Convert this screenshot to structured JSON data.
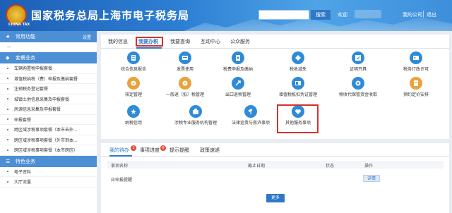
{
  "header": {
    "logo_text": "CHINA TAX",
    "title": "国家税务总局上海市电子税务局",
    "search_label": "搜索",
    "welcome": "欢迎",
    "my_company": "我的公司",
    "logout": "退出"
  },
  "sidebar": {
    "common": {
      "label": "常用功能",
      "settings": "设置",
      "items": [
        "--"
      ]
    },
    "business": {
      "label": "套餐业务",
      "items": [
        "车辆购置税申报套餐",
        "增值税纳税（费）申报及缴纳套餐",
        "注销税务登记套餐",
        "城镇土地信息采集及申报套餐",
        "房源信息采集及申报套餐",
        "申报套餐",
        "跨区域涉税事项套餐（本市去外...",
        "跨区域涉税事项套餐（外市到本...",
        "跨区域涉税事项套餐（本市跨区）"
      ]
    },
    "special": {
      "label": "特色业务",
      "items": [
        "电子资料",
        "大厅流量"
      ]
    }
  },
  "main": {
    "tabs": [
      "我的信息",
      "我要办税",
      "我要查询",
      "互动中心",
      "公众服务"
    ],
    "active_tab": "我要办税",
    "grid": [
      {
        "label": "综合信息报告",
        "icon": "report-icon",
        "color": "#2f8bd8"
      },
      {
        "label": "发票使用",
        "icon": "invoice-icon",
        "color": "#2f8bd8"
      },
      {
        "label": "税费申报及缴纳",
        "icon": "tax-declare-icon",
        "color": "#2f8bd8"
      },
      {
        "label": "税收减免",
        "icon": "tax-relief-icon",
        "color": "#2f8bd8"
      },
      {
        "label": "证明开具",
        "icon": "certificate-icon",
        "color": "#2f8bd8"
      },
      {
        "label": "税务行政许可",
        "icon": "license-icon",
        "color": "#2f8bd8"
      },
      {
        "label": "核定管理",
        "icon": "approve-icon",
        "color": "#e8a33d"
      },
      {
        "label": "一般退（抵）税管理",
        "icon": "refund-icon",
        "color": "#e8a33d"
      },
      {
        "label": "出口退税管理",
        "icon": "export-refund-icon",
        "color": "#2f8bd8"
      },
      {
        "label": "增值税抵扣凭证管理",
        "icon": "voucher-icon",
        "color": "#2f8bd8"
      },
      {
        "label": "税收代保管资金收取",
        "icon": "fund-icon",
        "color": "#2f8bd8"
      },
      {
        "label": "预约定价安排",
        "icon": "pricing-icon",
        "color": "#e8a33d"
      },
      {
        "label": "纳税信用",
        "icon": "credit-icon",
        "color": "#2f8bd8"
      },
      {
        "label": "涉税专业服务机构管理",
        "icon": "agency-icon",
        "color": "#2f8bd8"
      },
      {
        "label": "法律追责与救济事项",
        "icon": "legal-icon",
        "color": "#2f8bd8"
      },
      {
        "label": "其他服务事项",
        "icon": "other-service-icon",
        "color": "#2f8bd8"
      }
    ]
  },
  "todo": {
    "tabs": [
      "我的待办",
      "事项进度",
      "提示提醒",
      "政策速递"
    ],
    "badges": [
      "1",
      "0"
    ],
    "columns": [
      "事项名称",
      "截止日期",
      "状态",
      "操作"
    ],
    "rows": [
      {
        "name": "应申报提醒",
        "deadline": "",
        "status": "",
        "action": "详情"
      }
    ],
    "more": "更多"
  }
}
